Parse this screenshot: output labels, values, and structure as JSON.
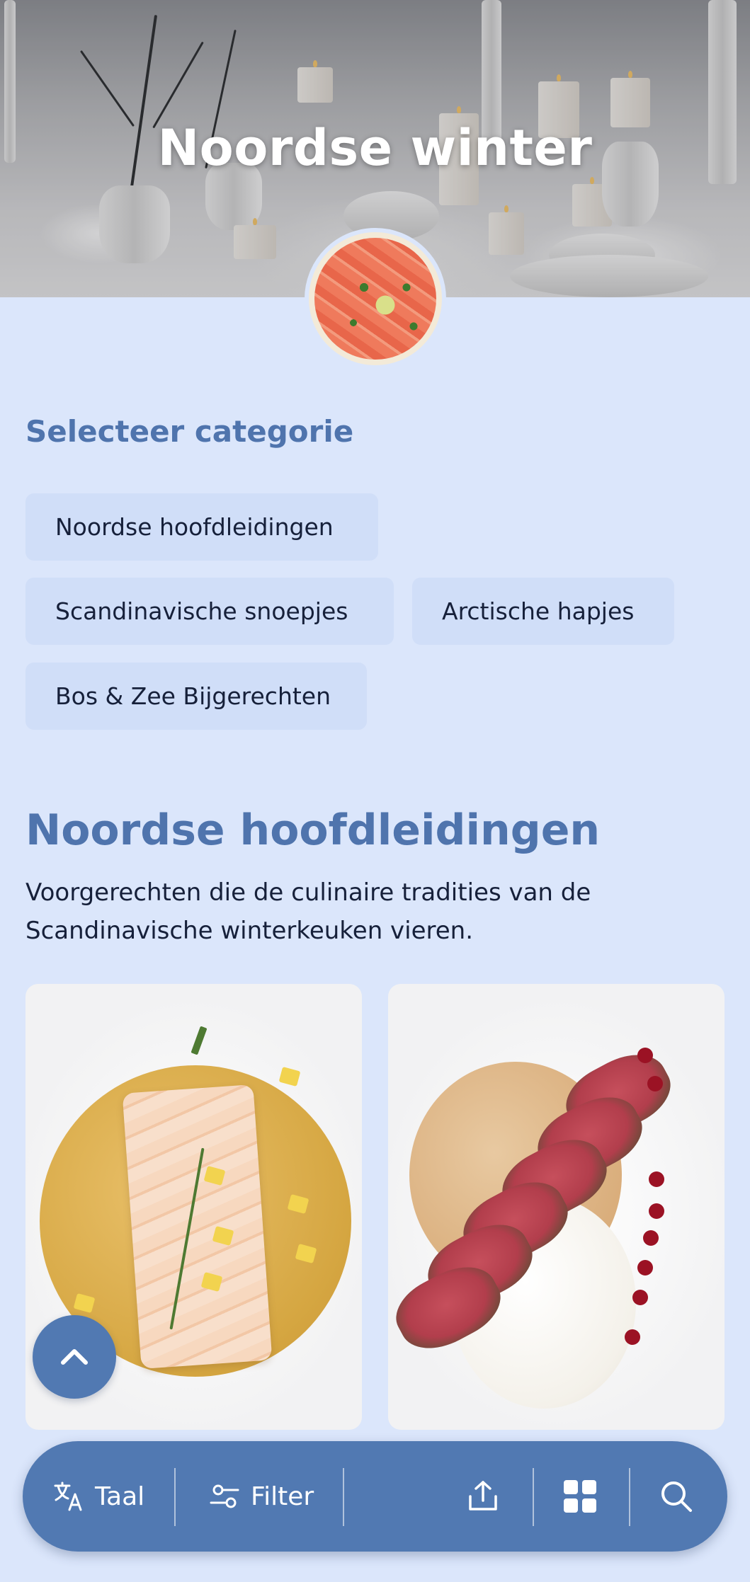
{
  "hero": {
    "title": "Noordse winter"
  },
  "categories": {
    "heading": "Selecteer categorie",
    "items": [
      {
        "label": "Noordse hoofdleidingen"
      },
      {
        "label": "Scandinavische snoepjes"
      },
      {
        "label": "Arctische hapjes"
      },
      {
        "label": "Bos & Zee Bijgerechten"
      }
    ]
  },
  "section": {
    "title": "Noordse hoofdleidingen",
    "description": "Voorgerechten die de culinaire tradities van de Scandinavische winterkeuken vieren."
  },
  "bottom_bar": {
    "language_label": "Taal",
    "filter_label": "Filter"
  },
  "colors": {
    "background": "#dbe6fb",
    "accent": "#4f74ad",
    "bar": "#5179b2",
    "chip": "#d0def8"
  },
  "icons": [
    "translate-icon",
    "filter-icon",
    "share-icon",
    "grid-icon",
    "search-icon",
    "chevron-up-icon"
  ]
}
